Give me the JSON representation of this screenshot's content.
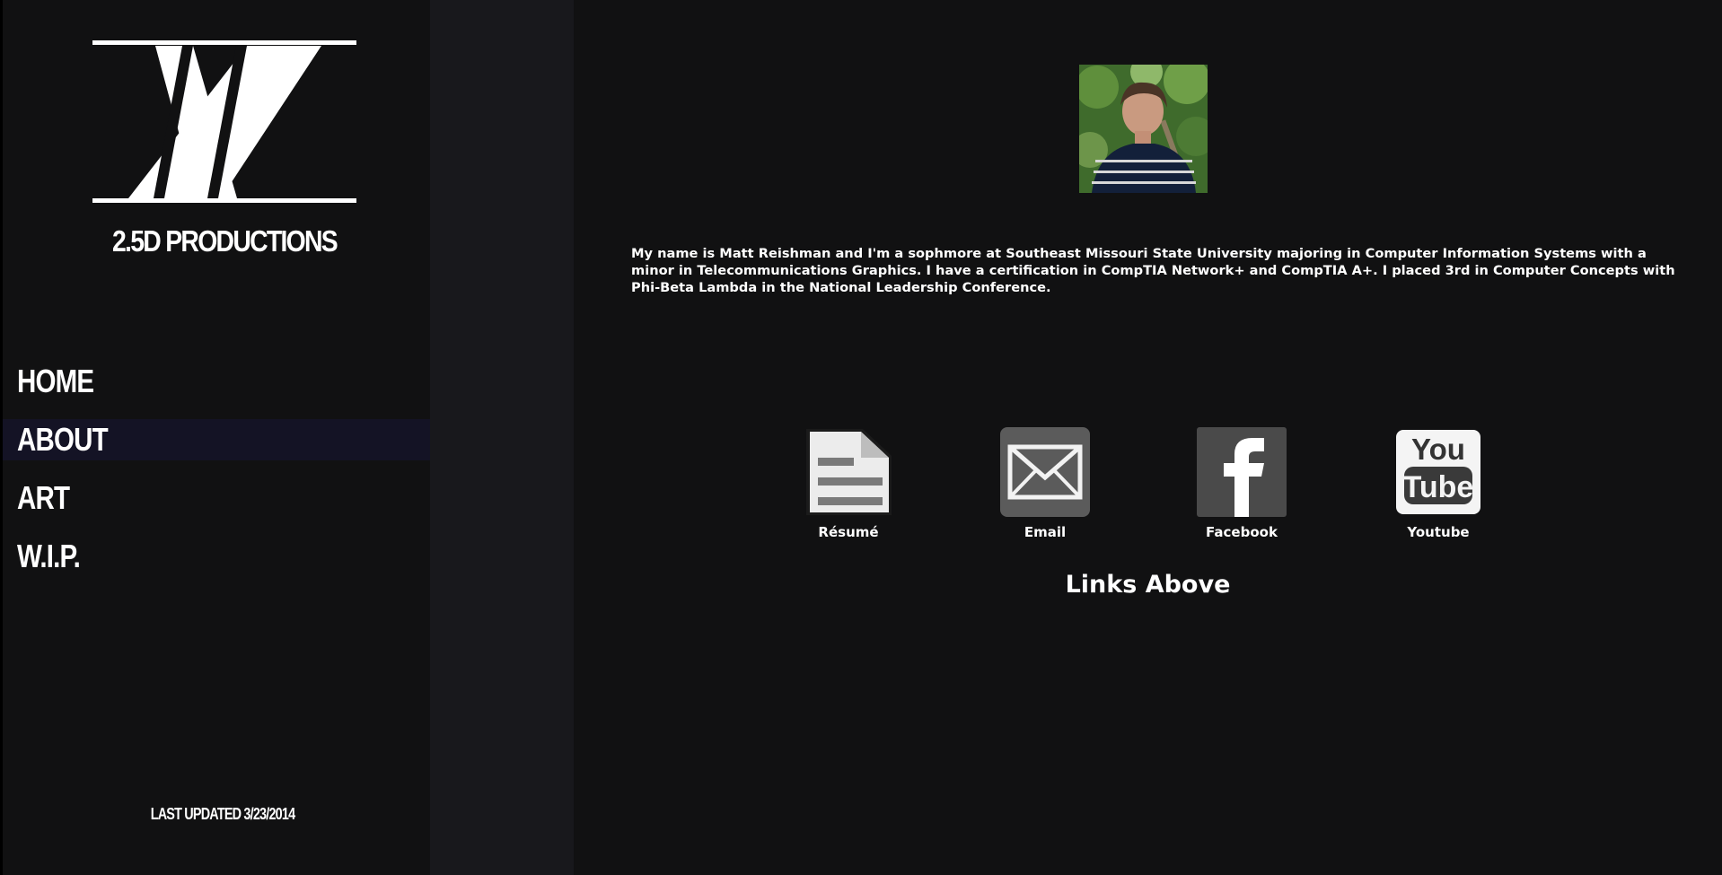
{
  "brand": {
    "name": "2.5D PRODUCTIONS",
    "logo_icon": "xx-logo-icon"
  },
  "nav": {
    "items": [
      {
        "label": "HOME",
        "active": false
      },
      {
        "label": "ABOUT",
        "active": true
      },
      {
        "label": "ART",
        "active": false
      },
      {
        "label": "W.I.P.",
        "active": false
      }
    ]
  },
  "footer": {
    "updated": "LAST UPDATED 3/23/2014"
  },
  "about": {
    "portrait_icon": "profile-photo",
    "bio": "My name is Matt Reishman and I'm a sophmore at Southeast Missouri State University majoring in Computer Information Systems with a minor in Telecommunications Graphics. I have a certification in CompTIA Network+ and CompTIA A+. I placed 3rd in Computer Concepts with Phi-Beta Lambda in the National Leadership Conference."
  },
  "links": [
    {
      "label": "Résumé",
      "icon": "document-icon"
    },
    {
      "label": "Email",
      "icon": "envelope-icon"
    },
    {
      "label": "Facebook",
      "icon": "facebook-icon"
    },
    {
      "label": "Youtube",
      "icon": "youtube-icon"
    }
  ],
  "links_heading": "Links Above",
  "colors": {
    "background": "#111112",
    "gutter": "#18181c",
    "active_nav": "#141325",
    "text": "#ffffff"
  }
}
